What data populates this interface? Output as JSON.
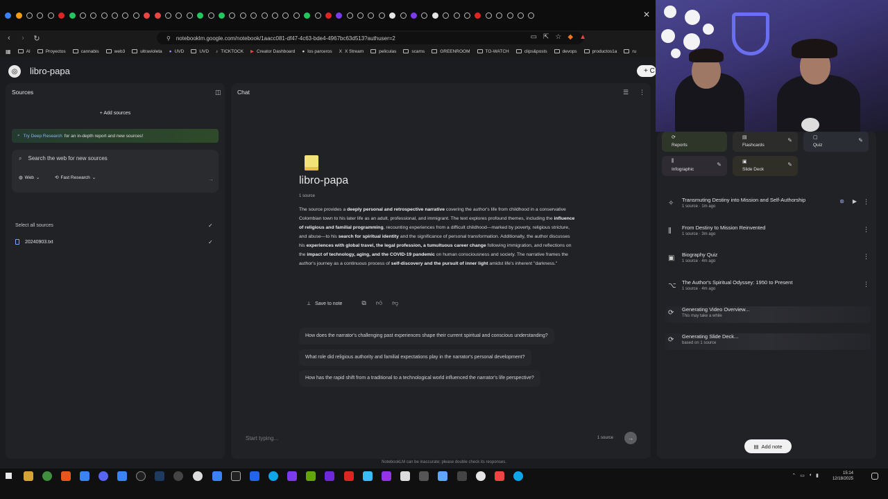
{
  "browser": {
    "url": "notebooklm.google.com/notebook/1aacc081-df47-4c63-bde4-4967bc63d513?authuser=2",
    "bookmarks": [
      "AI",
      "Proyectos",
      "cannabis",
      "web3",
      "ultravioleta",
      "UVD",
      "UVD",
      "TICKTOCK",
      "Creator Dashboard",
      "los parceros",
      "X Stream",
      "peliculas",
      "scams",
      "GREENROOM",
      "TO-WATCH",
      "clips&posts",
      "devops",
      "productos1a",
      "ru"
    ]
  },
  "app": {
    "title": "libro-papa",
    "create_label": "+ C"
  },
  "sources": {
    "header": "Sources",
    "add_label": "Add sources",
    "deep_research_link": "Try Deep Research",
    "deep_research_text": "for an in-depth report and new sources!",
    "search_placeholder": "Search the web for new sources",
    "chip_web": "Web",
    "chip_research": "Fast Research",
    "select_all": "Select all sources",
    "items": [
      {
        "name": "20240903.txt"
      }
    ]
  },
  "chat": {
    "header": "Chat",
    "notebook_title": "libro-papa",
    "source_count": "1 source",
    "summary": {
      "p1": "The source provides a ",
      "b1": "deeply personal and retrospective narrative",
      "p2": " covering the author's life from childhood in a conservative Colombian town to his later life as an adult, professional, and immigrant. The text explores profound themes, including the ",
      "b2": "influence of religious and familial programming",
      "p3": ", recounting experiences from a difficult childhood—marked by poverty, religious stricture, and abuse—to his ",
      "b3": "search for spiritual identity",
      "p4": " and the significance of personal transformation. Additionally, the author discusses his ",
      "b4": "experiences with global travel, the legal profession, a tumultuous career change",
      "p5": " following immigration, and reflections on the ",
      "b5": "impact of technology, aging, and the COVID-19 pandemic",
      "p6": " on human consciousness and society. The narrative frames the author's journey as a continuous process of ",
      "b6": "self-discovery and the pursuit of inner light",
      "p7": " amidst life's inherent \"darkness.\""
    },
    "save_to_note": "Save to note",
    "suggestions": [
      "How does the narrator's challenging past experiences shape their current spiritual and conscious understanding?",
      "What role did religious authority and familial expectations play in the narrator's personal development?",
      "How has the rapid shift from a traditional to a technological world influenced the narrator's life perspective?"
    ],
    "input_placeholder": "Start typing...",
    "input_source_count": "1 source"
  },
  "studio": {
    "cards": [
      {
        "icon": "reports-icon",
        "label": "Reports"
      },
      {
        "icon": "flashcards-icon",
        "label": "Flashcards"
      },
      {
        "icon": "quiz-icon",
        "label": "Quiz"
      },
      {
        "icon": "infographic-icon",
        "label": "Infographic"
      },
      {
        "icon": "slide-deck-icon",
        "label": "Slide Deck"
      }
    ],
    "artifacts": [
      {
        "title": "Transmuting Destiny into Mission and Self-Authorship",
        "sub": "1 source · 1m ago"
      },
      {
        "title": "From Destiny to Mission Reinvented",
        "sub": "1 source · 3m ago"
      },
      {
        "title": "Biography Quiz",
        "sub": "1 source · 4m ago"
      },
      {
        "title": "The Author's Spiritual Odyssey: 1950 to Present",
        "sub": "1 source · 4m ago"
      },
      {
        "title": "Generating Video Overview...",
        "sub": "This may take a while"
      },
      {
        "title": "Generating Slide Deck...",
        "sub": "based on 1 source"
      }
    ],
    "add_note": "Add note"
  },
  "disclaimer": "NotebookLM can be inaccurate; please double check its responses.",
  "taskbar": {
    "time": "15:14",
    "date": "12/18/2025"
  }
}
